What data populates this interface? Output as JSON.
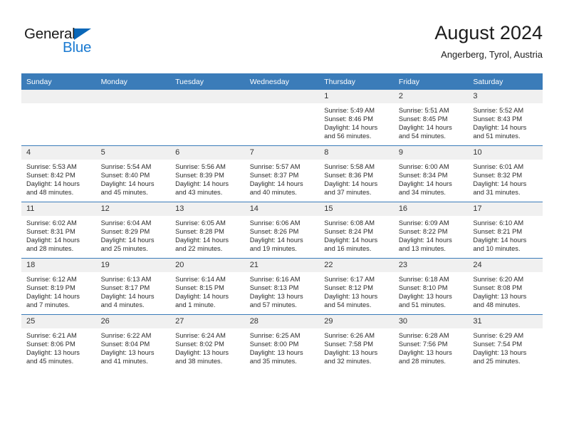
{
  "brand": {
    "name_part1": "General",
    "name_part2": "Blue",
    "logo_icon": "triangle-icon",
    "accent_color": "#1a7ad1"
  },
  "header": {
    "title": "August 2024",
    "subtitle": "Angerberg, Tyrol, Austria"
  },
  "calendar": {
    "header_color": "#3b7cb9",
    "weekday_headers": [
      "Sunday",
      "Monday",
      "Tuesday",
      "Wednesday",
      "Thursday",
      "Friday",
      "Saturday"
    ],
    "labels": {
      "sunrise": "Sunrise:",
      "sunset": "Sunset:",
      "daylight": "Daylight:"
    },
    "weeks": [
      [
        {
          "day": "",
          "empty": true
        },
        {
          "day": "",
          "empty": true
        },
        {
          "day": "",
          "empty": true
        },
        {
          "day": "",
          "empty": true
        },
        {
          "day": "1",
          "sunrise": "Sunrise: 5:49 AM",
          "sunset": "Sunset: 8:46 PM",
          "daylight": "Daylight: 14 hours and 56 minutes."
        },
        {
          "day": "2",
          "sunrise": "Sunrise: 5:51 AM",
          "sunset": "Sunset: 8:45 PM",
          "daylight": "Daylight: 14 hours and 54 minutes."
        },
        {
          "day": "3",
          "sunrise": "Sunrise: 5:52 AM",
          "sunset": "Sunset: 8:43 PM",
          "daylight": "Daylight: 14 hours and 51 minutes."
        }
      ],
      [
        {
          "day": "4",
          "sunrise": "Sunrise: 5:53 AM",
          "sunset": "Sunset: 8:42 PM",
          "daylight": "Daylight: 14 hours and 48 minutes."
        },
        {
          "day": "5",
          "sunrise": "Sunrise: 5:54 AM",
          "sunset": "Sunset: 8:40 PM",
          "daylight": "Daylight: 14 hours and 45 minutes."
        },
        {
          "day": "6",
          "sunrise": "Sunrise: 5:56 AM",
          "sunset": "Sunset: 8:39 PM",
          "daylight": "Daylight: 14 hours and 43 minutes."
        },
        {
          "day": "7",
          "sunrise": "Sunrise: 5:57 AM",
          "sunset": "Sunset: 8:37 PM",
          "daylight": "Daylight: 14 hours and 40 minutes."
        },
        {
          "day": "8",
          "sunrise": "Sunrise: 5:58 AM",
          "sunset": "Sunset: 8:36 PM",
          "daylight": "Daylight: 14 hours and 37 minutes."
        },
        {
          "day": "9",
          "sunrise": "Sunrise: 6:00 AM",
          "sunset": "Sunset: 8:34 PM",
          "daylight": "Daylight: 14 hours and 34 minutes."
        },
        {
          "day": "10",
          "sunrise": "Sunrise: 6:01 AM",
          "sunset": "Sunset: 8:32 PM",
          "daylight": "Daylight: 14 hours and 31 minutes."
        }
      ],
      [
        {
          "day": "11",
          "sunrise": "Sunrise: 6:02 AM",
          "sunset": "Sunset: 8:31 PM",
          "daylight": "Daylight: 14 hours and 28 minutes."
        },
        {
          "day": "12",
          "sunrise": "Sunrise: 6:04 AM",
          "sunset": "Sunset: 8:29 PM",
          "daylight": "Daylight: 14 hours and 25 minutes."
        },
        {
          "day": "13",
          "sunrise": "Sunrise: 6:05 AM",
          "sunset": "Sunset: 8:28 PM",
          "daylight": "Daylight: 14 hours and 22 minutes."
        },
        {
          "day": "14",
          "sunrise": "Sunrise: 6:06 AM",
          "sunset": "Sunset: 8:26 PM",
          "daylight": "Daylight: 14 hours and 19 minutes."
        },
        {
          "day": "15",
          "sunrise": "Sunrise: 6:08 AM",
          "sunset": "Sunset: 8:24 PM",
          "daylight": "Daylight: 14 hours and 16 minutes."
        },
        {
          "day": "16",
          "sunrise": "Sunrise: 6:09 AM",
          "sunset": "Sunset: 8:22 PM",
          "daylight": "Daylight: 14 hours and 13 minutes."
        },
        {
          "day": "17",
          "sunrise": "Sunrise: 6:10 AM",
          "sunset": "Sunset: 8:21 PM",
          "daylight": "Daylight: 14 hours and 10 minutes."
        }
      ],
      [
        {
          "day": "18",
          "sunrise": "Sunrise: 6:12 AM",
          "sunset": "Sunset: 8:19 PM",
          "daylight": "Daylight: 14 hours and 7 minutes."
        },
        {
          "day": "19",
          "sunrise": "Sunrise: 6:13 AM",
          "sunset": "Sunset: 8:17 PM",
          "daylight": "Daylight: 14 hours and 4 minutes."
        },
        {
          "day": "20",
          "sunrise": "Sunrise: 6:14 AM",
          "sunset": "Sunset: 8:15 PM",
          "daylight": "Daylight: 14 hours and 1 minute."
        },
        {
          "day": "21",
          "sunrise": "Sunrise: 6:16 AM",
          "sunset": "Sunset: 8:13 PM",
          "daylight": "Daylight: 13 hours and 57 minutes."
        },
        {
          "day": "22",
          "sunrise": "Sunrise: 6:17 AM",
          "sunset": "Sunset: 8:12 PM",
          "daylight": "Daylight: 13 hours and 54 minutes."
        },
        {
          "day": "23",
          "sunrise": "Sunrise: 6:18 AM",
          "sunset": "Sunset: 8:10 PM",
          "daylight": "Daylight: 13 hours and 51 minutes."
        },
        {
          "day": "24",
          "sunrise": "Sunrise: 6:20 AM",
          "sunset": "Sunset: 8:08 PM",
          "daylight": "Daylight: 13 hours and 48 minutes."
        }
      ],
      [
        {
          "day": "25",
          "sunrise": "Sunrise: 6:21 AM",
          "sunset": "Sunset: 8:06 PM",
          "daylight": "Daylight: 13 hours and 45 minutes."
        },
        {
          "day": "26",
          "sunrise": "Sunrise: 6:22 AM",
          "sunset": "Sunset: 8:04 PM",
          "daylight": "Daylight: 13 hours and 41 minutes."
        },
        {
          "day": "27",
          "sunrise": "Sunrise: 6:24 AM",
          "sunset": "Sunset: 8:02 PM",
          "daylight": "Daylight: 13 hours and 38 minutes."
        },
        {
          "day": "28",
          "sunrise": "Sunrise: 6:25 AM",
          "sunset": "Sunset: 8:00 PM",
          "daylight": "Daylight: 13 hours and 35 minutes."
        },
        {
          "day": "29",
          "sunrise": "Sunrise: 6:26 AM",
          "sunset": "Sunset: 7:58 PM",
          "daylight": "Daylight: 13 hours and 32 minutes."
        },
        {
          "day": "30",
          "sunrise": "Sunrise: 6:28 AM",
          "sunset": "Sunset: 7:56 PM",
          "daylight": "Daylight: 13 hours and 28 minutes."
        },
        {
          "day": "31",
          "sunrise": "Sunrise: 6:29 AM",
          "sunset": "Sunset: 7:54 PM",
          "daylight": "Daylight: 13 hours and 25 minutes."
        }
      ]
    ]
  }
}
